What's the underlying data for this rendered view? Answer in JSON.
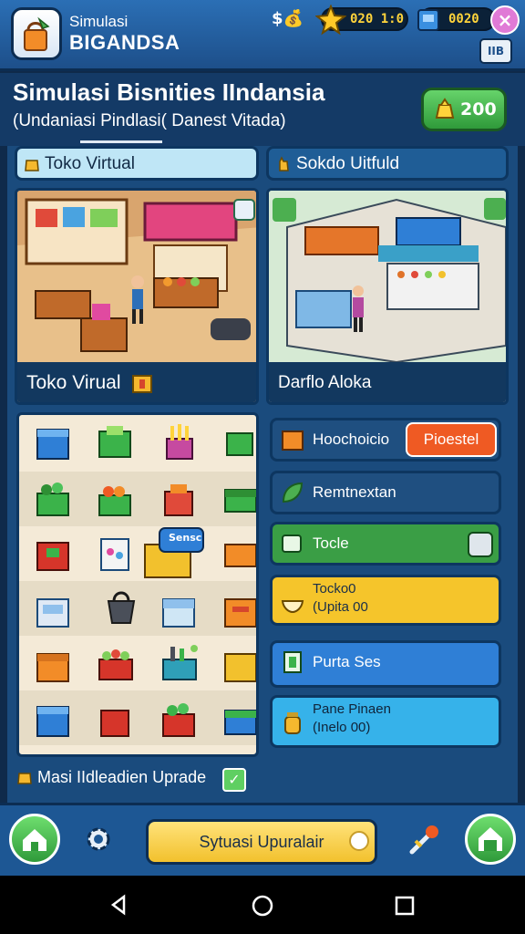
{
  "topbar": {
    "brand_line1": "Simulasi",
    "brand_line2": "BIGANDSA",
    "money_symbol": "$💰",
    "counter1": "020 1:0",
    "counter2": "0020",
    "side_button_label": "IIB"
  },
  "header": {
    "title": "Simulasi Bisnities IIndansia",
    "subtitle": "(Undaniasi Pindlasi( Danest Vitada)",
    "coins": "200"
  },
  "tabs": [
    {
      "label": "Toko Virtual"
    },
    {
      "label": "Sokdo Uitfuld"
    }
  ],
  "shops": [
    {
      "label": "Toko Virual"
    },
    {
      "label": "Darflo Aloka"
    }
  ],
  "actions": {
    "a1_label": "Hoochoicio",
    "a1_button": "Pioestel",
    "a2_label": "Remtnextan",
    "a3_label": "Tocle",
    "a4_line1": "Tocko0",
    "a4_line2": "(Upita 00",
    "a5_label": "Purta Ses",
    "a6_line1": "Pane Pinaen",
    "a6_line2": "(Inelo 00)"
  },
  "inventory": {
    "sign_label": "Sensc",
    "upgrade_label": "Masi IIdleadien Uprade"
  },
  "bottom": {
    "main_button": "Sytuasi Upuralair"
  },
  "colors": {
    "primary_blue": "#1d5794",
    "accent_green": "#3bb34a",
    "accent_yellow": "#f2c12d",
    "accent_orange": "#ef5a23"
  }
}
